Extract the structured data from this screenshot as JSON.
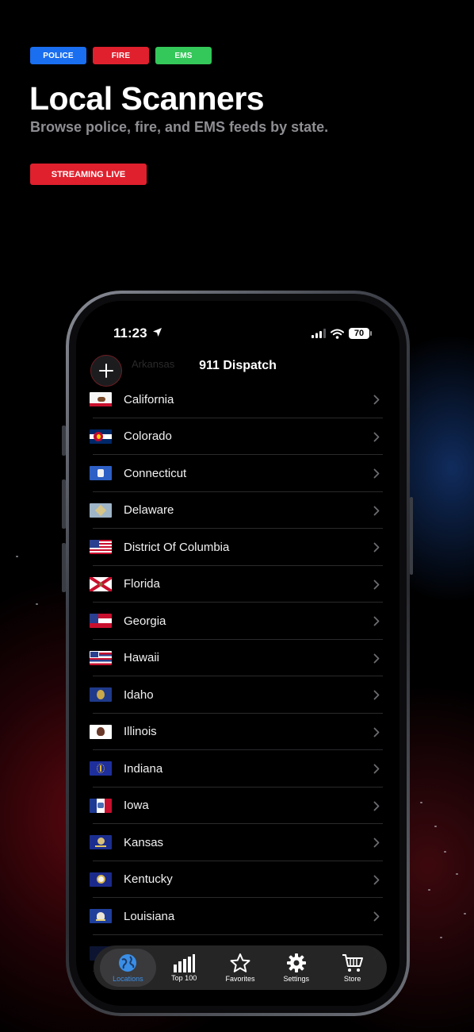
{
  "tags": [
    {
      "label": "POLICE",
      "color": "#1a6ef0"
    },
    {
      "label": "FIRE",
      "color": "#e0202d"
    },
    {
      "label": "EMS",
      "color": "#34c759"
    }
  ],
  "headline": "Local Scanners",
  "subheadline": "Browse police, fire, and EMS feeds by state.",
  "live_button": "STREAMING LIVE",
  "status_bar": {
    "time": "11:23",
    "battery": "70"
  },
  "nav": {
    "title": "911 Dispatch",
    "ghost_row": "Arkansas"
  },
  "states": [
    {
      "name": "California",
      "flag": "california-flag-icon"
    },
    {
      "name": "Colorado",
      "flag": "colorado-flag-icon"
    },
    {
      "name": "Connecticut",
      "flag": "connecticut-flag-icon"
    },
    {
      "name": "Delaware",
      "flag": "delaware-flag-icon"
    },
    {
      "name": "District Of Columbia",
      "flag": "dc-flag-icon"
    },
    {
      "name": "Florida",
      "flag": "florida-flag-icon"
    },
    {
      "name": "Georgia",
      "flag": "georgia-flag-icon"
    },
    {
      "name": "Hawaii",
      "flag": "hawaii-flag-icon"
    },
    {
      "name": "Idaho",
      "flag": "idaho-flag-icon"
    },
    {
      "name": "Illinois",
      "flag": "illinois-flag-icon"
    },
    {
      "name": "Indiana",
      "flag": "indiana-flag-icon"
    },
    {
      "name": "Iowa",
      "flag": "iowa-flag-icon"
    },
    {
      "name": "Kansas",
      "flag": "kansas-flag-icon"
    },
    {
      "name": "Kentucky",
      "flag": "kentucky-flag-icon"
    },
    {
      "name": "Louisiana",
      "flag": "louisiana-flag-icon"
    }
  ],
  "tabs": [
    {
      "label": "Locations",
      "icon": "globe-icon",
      "active": true
    },
    {
      "label": "Top 100",
      "icon": "bar-chart-icon",
      "active": false
    },
    {
      "label": "Favorites",
      "icon": "star-icon",
      "active": false
    },
    {
      "label": "Settings",
      "icon": "gear-icon",
      "active": false
    },
    {
      "label": "Store",
      "icon": "cart-icon",
      "active": false
    }
  ],
  "colors": {
    "accent": "#3a8ee6",
    "live_red": "#e0202d"
  }
}
